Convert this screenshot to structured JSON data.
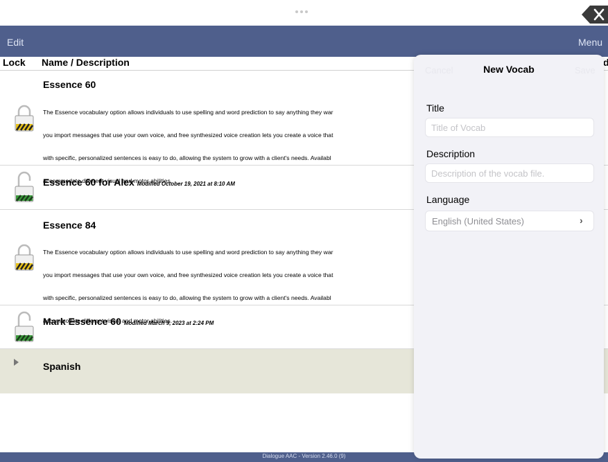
{
  "top_bar": {
    "close_icon": "x-close-icon"
  },
  "nav": {
    "edit_label": "Edit",
    "menu_label": "Menu",
    "color": "#4f5f8c"
  },
  "table_header": {
    "lock": "Lock",
    "name": "Name / Description",
    "right_clip": "d"
  },
  "rows": [
    {
      "title": "Essence 60",
      "modified": "",
      "description_lines": [
        "The Essence vocabulary option allows individuals to use spelling and word prediction to say anything they war",
        "you import messages that use your own voice, and free synthesized voice creation lets you create a voice that",
        "with specific, personalized sentences is easy to do, allowing the system to grow with a client's needs. Availabl",
        "accommodate different visual and motor abilities."
      ],
      "lock_state": "locked"
    },
    {
      "title": "Essence 60 for Alex",
      "modified": "Modified October 19, 2021 at 8:10 AM",
      "lock_state": "unlocked"
    },
    {
      "title": "Essence 84",
      "modified": "",
      "description_lines": [
        "The Essence vocabulary option allows individuals to use spelling and word prediction to say anything they war",
        "you import messages that use your own voice, and free synthesized voice creation lets you create a voice that",
        "with specific, personalized sentences is easy to do, allowing the system to grow with a client's needs. Availabl",
        "accommodate different visual and motor abilities."
      ],
      "lock_state": "locked"
    },
    {
      "title": "Mark Essence 60",
      "modified": "Modified March 9, 2023 at 2:24 PM",
      "lock_state": "unlocked"
    }
  ],
  "group": {
    "label": "Spanish",
    "icon": "disclosure-triangle-icon"
  },
  "footer": {
    "version": "Dialogue AAC - Version 2.46.0 (9)"
  },
  "new_vocab": {
    "cancel_label": "Cancel",
    "title": "New Vocab",
    "save_label": "Save",
    "title_label": "Title",
    "title_placeholder": "Title of Vocab",
    "description_label": "Description",
    "description_placeholder": "Description of the vocab file.",
    "language_label": "Language",
    "language_value": "English (United States)",
    "chevron_icon": "chevron-right-icon"
  }
}
